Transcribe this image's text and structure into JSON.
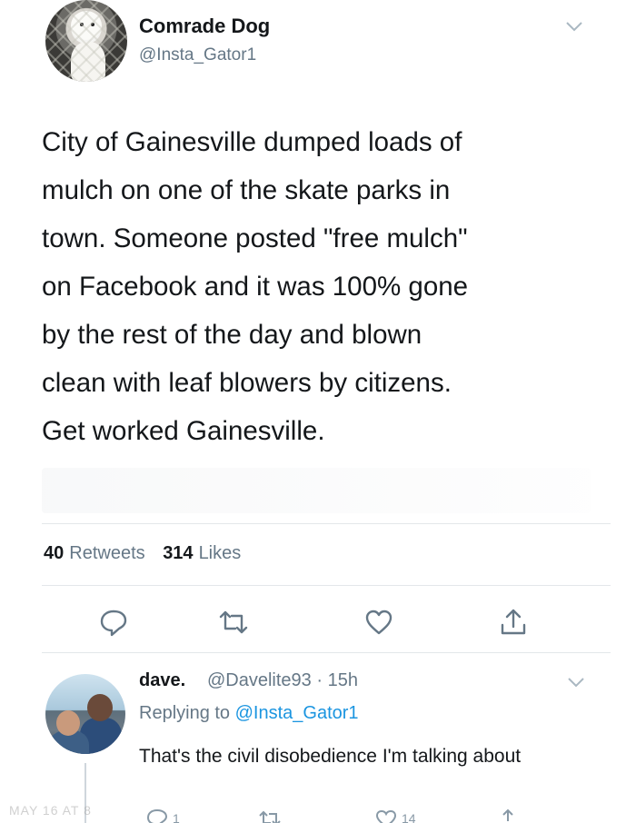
{
  "tweet": {
    "display_name": "Comrade Dog",
    "handle": "@Insta_Gator1",
    "text": "City of Gainesville dumped loads of\nmulch on one of the skate parks in\ntown. Someone posted \"free mulch\"\non Facebook and it was 100% gone\nby the rest of the day and blown\nclean with leaf blowers by citizens.\nGet worked Gainesville.",
    "retweets_count": "40",
    "retweets_label": "Retweets",
    "likes_count": "314",
    "likes_label": "Likes"
  },
  "actions": {
    "icons": [
      "reply-icon",
      "retweet-icon",
      "like-icon",
      "share-icon"
    ]
  },
  "reply": {
    "display_name": "dave.",
    "handle_time": "@Davelite93 · 15h",
    "replying_prefix": "Replying to",
    "replying_handle": "@Insta_Gator1",
    "text": "That's the civil disobedience I'm talking about",
    "reply_count": "1",
    "like_count": "14"
  },
  "watermark": "MAY 16 AT 8",
  "colors": {
    "text": "#14171a",
    "secondary": "#657786",
    "link": "#1b95e0",
    "divider": "#e3e7ea"
  }
}
